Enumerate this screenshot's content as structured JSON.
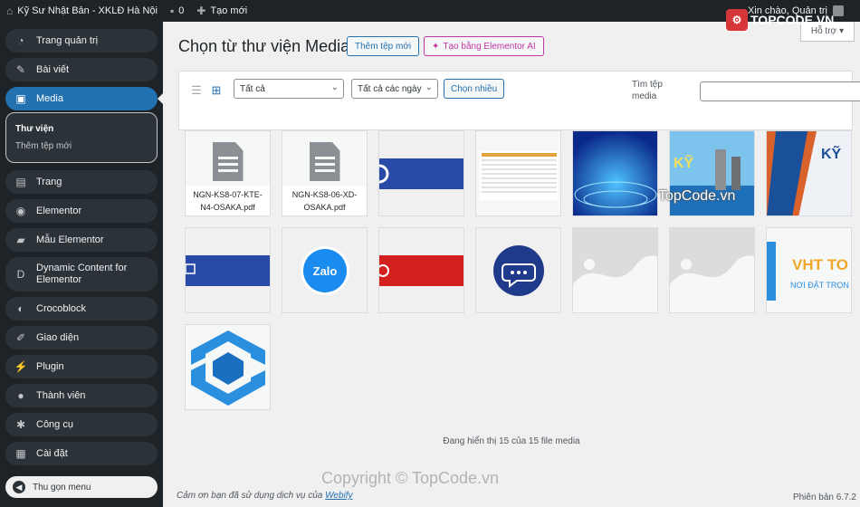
{
  "adminbar": {
    "site_name": "Kỹ Sư Nhật Bản - XKLĐ Hà Nội",
    "comments_count": "0",
    "new_label": "Tạo mới",
    "greeting": "Xin chào, Quản trị"
  },
  "sidebar": {
    "items": [
      {
        "label": "Trang quản trị",
        "icon": "dashboard-icon"
      },
      {
        "label": "Bài viết",
        "icon": "pin-icon"
      },
      {
        "label": "Media",
        "icon": "media-icon"
      },
      {
        "label": "Trang",
        "icon": "page-icon"
      },
      {
        "label": "Elementor",
        "icon": "elementor-icon"
      },
      {
        "label": "Mẫu Elementor",
        "icon": "folder-icon"
      },
      {
        "label": "Dynamic Content for Elementor",
        "icon": "dynamic-icon"
      },
      {
        "label": "Crocoblock",
        "icon": "crocoblock-icon"
      },
      {
        "label": "Giao diện",
        "icon": "brush-icon"
      },
      {
        "label": "Plugin",
        "icon": "plugin-icon"
      },
      {
        "label": "Thành viên",
        "icon": "user-icon"
      },
      {
        "label": "Công cụ",
        "icon": "wrench-icon"
      },
      {
        "label": "Cài đặt",
        "icon": "settings-icon"
      }
    ],
    "submenu": {
      "current": "Thư viện",
      "other": "Thêm tệp mới"
    },
    "collapse_label": "Thu gọn menu"
  },
  "header": {
    "title": "Chọn từ thư viện Media",
    "add_new": "Thêm tệp mới",
    "elementor_ai": "Tạo bằng Elementor AI",
    "help": "Hỗ trợ"
  },
  "toolbar": {
    "type_filter": "Tất cả",
    "date_filter": "Tất cả các ngày",
    "bulk_select": "Chọn nhiều",
    "search_label": "Tìm tệp media",
    "search_value": ""
  },
  "files": [
    {
      "name": "NGN-KS8-07-KTE-N4-OSAKA.pdf"
    },
    {
      "name": "NGN-KS8-06-XD-OSAKA.pdf"
    }
  ],
  "count_text": "Đang hiển thị 15 của 15 file media",
  "footer": {
    "thanks_prefix": "Cảm ơn bạn đã sử dụng dịch vụ của",
    "thanks_link": "Webify",
    "version": "Phiên bản 6.7.2"
  },
  "watermark": {
    "logo_text": "TOPCODE.VN",
    "center_text": "TopCode.vn",
    "copyright": "Copyright © TopCode.vn"
  },
  "colors": {
    "admin_dark": "#1d2327",
    "accent_blue": "#2271b1",
    "elementor_pink": "#c036a3"
  }
}
